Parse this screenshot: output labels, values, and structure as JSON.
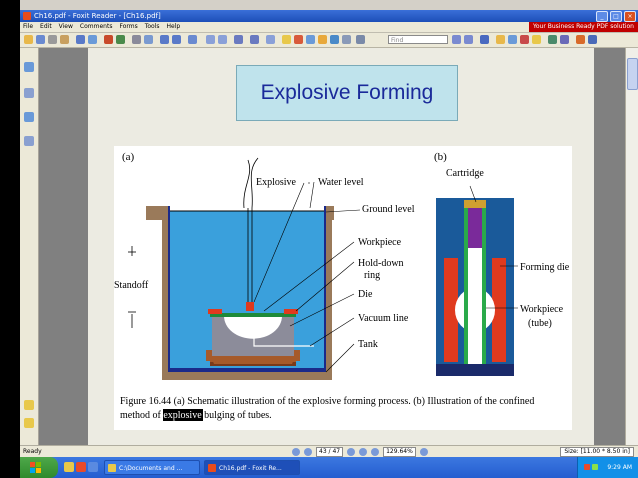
{
  "window": {
    "title": "Ch16.pdf - Foxit Reader - [Ch16.pdf]"
  },
  "menu": {
    "items": [
      "File",
      "Edit",
      "View",
      "Comments",
      "Forms",
      "Tools",
      "Help"
    ],
    "promo": "Your Business Ready PDF solution"
  },
  "toolbar": {
    "find_placeholder": "Find"
  },
  "slide": {
    "title": "Explosive Forming"
  },
  "figure": {
    "label_a": "(a)",
    "label_b": "(b)",
    "explosive": "Explosive",
    "water_level": "Water  level",
    "ground_level": "Ground  level",
    "workpiece": "Workpiece",
    "holddown_1": "Hold-down",
    "holddown_2": "ring",
    "die": "Die",
    "vacuum_line": "Vacuum  line",
    "tank": "Tank",
    "standoff": "Standoff",
    "cartridge": "Cartridge",
    "forming_die": "Forming  die",
    "workpiece_b": "Workpiece",
    "tube": "(tube)",
    "caption_line1": "Figure 16.44  (a) Schematic illustration of the explosive forming process.  (b) Illustration of the confined",
    "caption_pre": "method of ",
    "caption_highlight": "explosive",
    "caption_post": " bulging of tubes."
  },
  "status": {
    "ready": "Ready",
    "page_indicator": "43 / 47",
    "zoom": "129.64%",
    "page_size": "Size: [11.00 * 8.50 in]"
  },
  "taskbar": {
    "task1": "C:\\Documents and ...",
    "task2": "Ch16.pdf - Foxit Re...",
    "clock": "9:29 AM"
  },
  "colors": {
    "water": "#3aa0dc",
    "tank_wall": "#1a2a8a",
    "die": "#8c8c9a",
    "forming_die": "#e03a1e",
    "cartridge": "#7a2a9a"
  }
}
